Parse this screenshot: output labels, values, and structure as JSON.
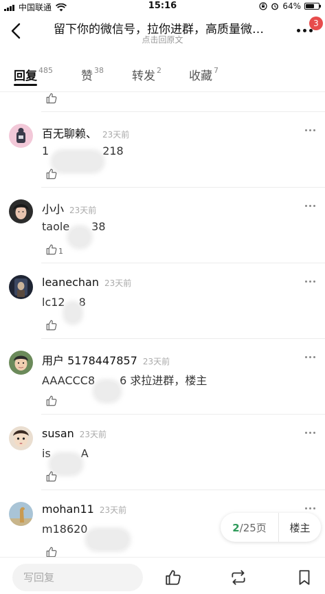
{
  "status_bar": {
    "carrier": "中国联通",
    "time": "15:16",
    "battery": "64%",
    "battery_level": 0.64
  },
  "nav": {
    "title": "留下你的微信号，拉你进群，高质量微…",
    "subtitle": "点击回原文",
    "notification_count": "3"
  },
  "tabs": [
    {
      "label": "回复",
      "count": "485"
    },
    {
      "label": "赞",
      "count": "38"
    },
    {
      "label": "转发",
      "count": "2"
    },
    {
      "label": "收藏",
      "count": "7"
    }
  ],
  "replies": [
    {
      "name": "百无聊赖、",
      "time": "23天前",
      "content_a": "1",
      "content_b": "218",
      "like_count": ""
    },
    {
      "name": "小小",
      "time": "23天前",
      "content_a": "taole",
      "content_b": "38",
      "like_count": "1"
    },
    {
      "name": "leanechan",
      "time": "23天前",
      "content_a": "lc12",
      "content_b": "8",
      "like_count": ""
    },
    {
      "name": "用户 5178447857",
      "time": "23天前",
      "content_a": "AAACCC8",
      "content_b": "6 求拉进群，楼主",
      "like_count": ""
    },
    {
      "name": "susan",
      "time": "23天前",
      "content_a": "is",
      "content_b": "A",
      "like_count": ""
    },
    {
      "name": "mohan11",
      "time": "23天前",
      "content_a": "m18620",
      "content_b": "",
      "like_count": ""
    }
  ],
  "pager": {
    "current": "2",
    "total_label": "/25页",
    "op_author": "楼主"
  },
  "bottom_bar": {
    "reply_placeholder": "写回复"
  },
  "icons": {
    "back": "chevron-left-icon",
    "more": "more-dots-icon",
    "like": "thumbs-up-icon",
    "repost": "repost-icon",
    "bookmark": "bookmark-icon"
  },
  "colors": {
    "badge": "#e74c4c",
    "page_current": "#2e9a5a"
  }
}
